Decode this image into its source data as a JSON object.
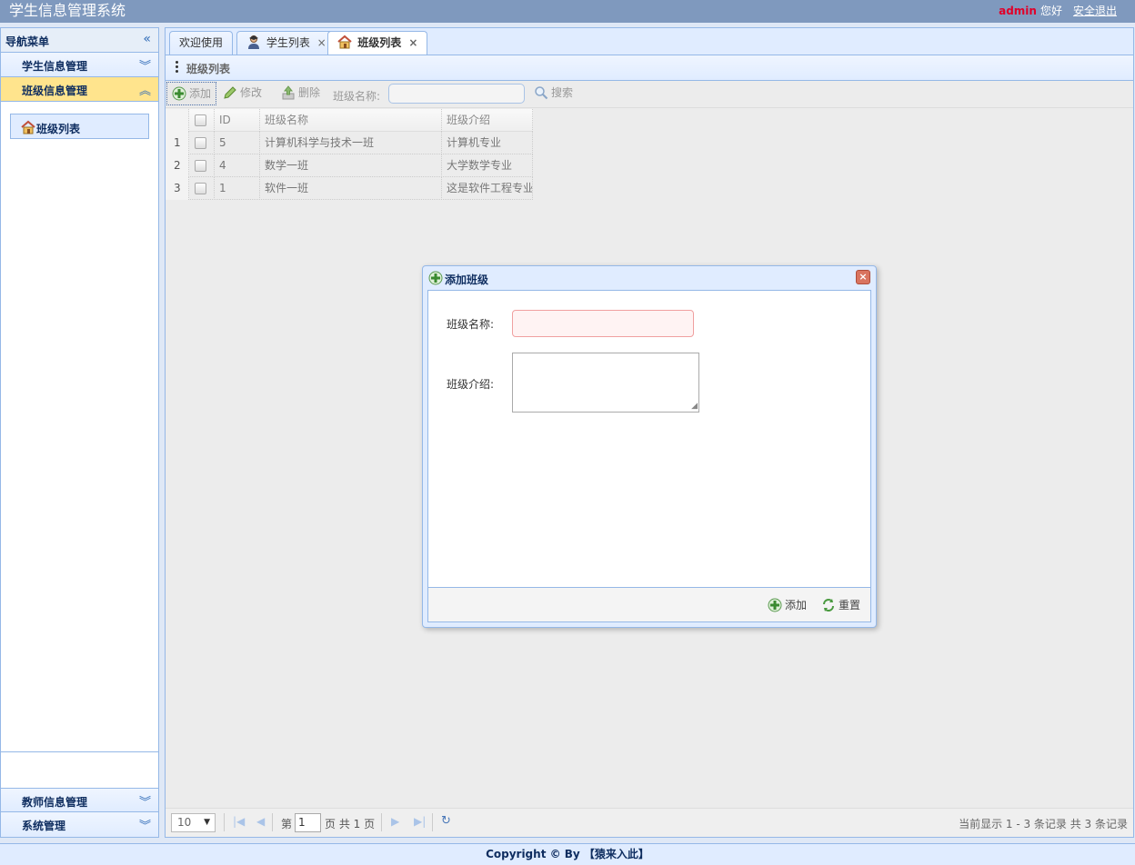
{
  "app": {
    "title": "学生信息管理系统"
  },
  "user": {
    "name": "admin",
    "greeting": "您好",
    "logout": "安全退出"
  },
  "nav": {
    "header": "导航菜单",
    "groups": [
      {
        "label": "学生信息管理"
      },
      {
        "label": "班级信息管理"
      },
      {
        "label": "教师信息管理"
      },
      {
        "label": "系统管理"
      }
    ],
    "active_item": "班级列表"
  },
  "tabs": [
    {
      "label": "欢迎使用"
    },
    {
      "label": "学生列表"
    },
    {
      "label": "班级列表"
    }
  ],
  "panel": {
    "title": "班级列表"
  },
  "toolbar": {
    "add": "添加",
    "edit": "修改",
    "delete": "删除",
    "search_label": "班级名称:",
    "search_value": "",
    "search_button": "搜索"
  },
  "grid": {
    "columns": [
      "ID",
      "班级名称",
      "班级介绍"
    ],
    "rows": [
      {
        "num": "1",
        "id": "5",
        "name": "计算机科学与技术一班",
        "intro": "计算机专业"
      },
      {
        "num": "2",
        "id": "4",
        "name": "数学一班",
        "intro": "大学数学专业"
      },
      {
        "num": "3",
        "id": "1",
        "name": "软件一班",
        "intro": "这是软件工程专业"
      }
    ]
  },
  "pager": {
    "page_size": "10",
    "page_prefix": "第",
    "current_page": "1",
    "page_suffix": "页 共 1 页",
    "info": "当前显示 1 - 3 条记录 共 3 条记录"
  },
  "dialog": {
    "title": "添加班级",
    "name_label": "班级名称:",
    "intro_label": "班级介绍:",
    "name_value": "",
    "intro_value": "",
    "add_button": "添加",
    "reset_button": "重置"
  },
  "footer": {
    "text": "Copyright © By 【猿来入此】"
  }
}
